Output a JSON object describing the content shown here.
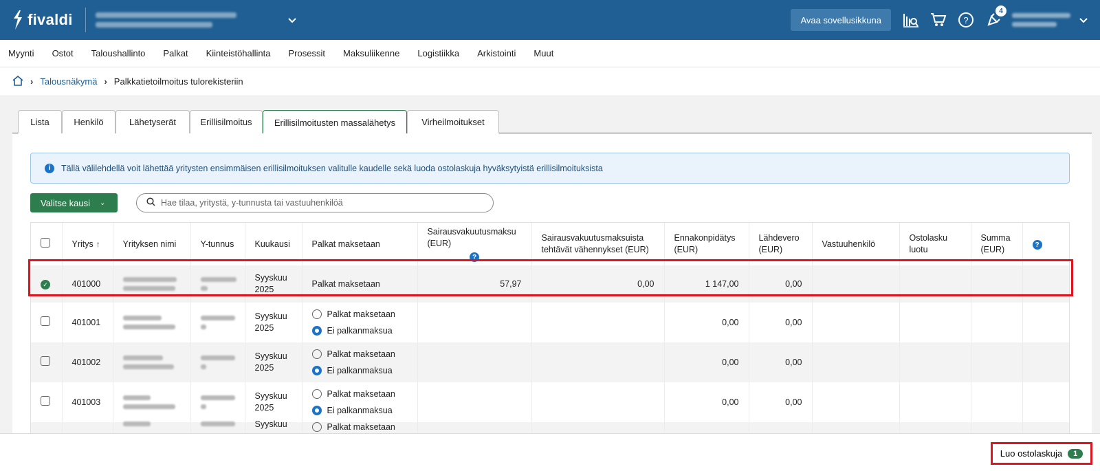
{
  "header": {
    "logo_text": "fivaldi",
    "open_app_label": "Avaa sovellusikkuna",
    "notification_count": "4"
  },
  "menu": [
    "Myynti",
    "Ostot",
    "Taloushallinto",
    "Palkat",
    "Kiinteistöhallinta",
    "Prosessit",
    "Maksuliikenne",
    "Logistiikka",
    "Arkistointi",
    "Muut"
  ],
  "breadcrumb": {
    "parent": "Talousnäkymä",
    "current": "Palkkatietoilmoitus tulorekisteriin"
  },
  "tabs": [
    "Lista",
    "Henkilö",
    "Lähetyserät",
    "Erillisilmoitus",
    "Erillisilmoitusten massalähetys",
    "Virheilmoitukset"
  ],
  "active_tab_index": 4,
  "info_text": "Tällä välilehdellä voit lähettää yritysten ensimmäisen erillisilmoituksen valitulle kaudelle sekä luoda ostolaskuja hyväksytyistä erillisilmoituksista",
  "period_button_label": "Valitse kausi",
  "search_placeholder": "Hae tilaa, yritystä, y-tunnusta tai vastuuhenkilöä",
  "table": {
    "columns": [
      "Yritys",
      "Yrityksen nimi",
      "Y-tunnus",
      "Kuukausi",
      "Palkat maksetaan",
      "Sairausvakuutusmaksu (EUR)",
      "Sairausvakuutusmaksuista tehtävät vähennykset (EUR)",
      "Ennakonpidätys (EUR)",
      "Lähdevero (EUR)",
      "Vastuuhenkilö",
      "Ostolasku luotu",
      "Summa (EUR)"
    ],
    "rows": [
      {
        "company": "401000",
        "month": "Syyskuu 2025",
        "pay": "Palkat maksetaan",
        "sv": "57,97",
        "svv": "0,00",
        "ennak": "1 147,00",
        "lahde": "0,00",
        "selected": true
      },
      {
        "company": "401001",
        "month": "Syyskuu 2025",
        "opt1": "Palkat maksetaan",
        "opt2": "Ei palkanmaksua",
        "ennak": "0,00",
        "lahde": "0,00",
        "selected": false
      },
      {
        "company": "401002",
        "month": "Syyskuu 2025",
        "opt1": "Palkat maksetaan",
        "opt2": "Ei palkanmaksua",
        "ennak": "0,00",
        "lahde": "0,00",
        "selected": false
      },
      {
        "company": "401003",
        "month": "Syyskuu 2025",
        "opt1": "Palkat maksetaan",
        "opt2": "Ei palkanmaksua",
        "ennak": "0,00",
        "lahde": "0,00",
        "selected": false
      },
      {
        "month": "Syyskuu",
        "opt1": "Palkat maksetaan"
      }
    ]
  },
  "footer": {
    "create_label": "Luo ostolaskuja",
    "create_count": "1"
  },
  "colors": {
    "header": "#1f5f93",
    "accent_green": "#2e7d4f",
    "highlight_red": "#e0141e",
    "info_blue": "#1a73c8"
  }
}
